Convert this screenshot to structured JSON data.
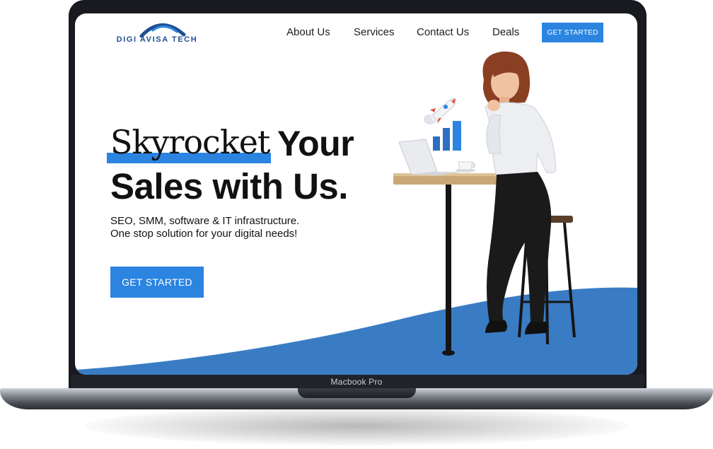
{
  "device": {
    "model_label": "Macbook Pro"
  },
  "brand": {
    "logo_text": "DIGI AVISA TECH",
    "logo_icon": "arc-swoosh-icon"
  },
  "nav": {
    "items": [
      {
        "label": "About Us"
      },
      {
        "label": "Services"
      },
      {
        "label": "Contact Us"
      },
      {
        "label": "Deals"
      }
    ],
    "cta_label": "GET STARTED"
  },
  "hero": {
    "headline_script": "Skyrocket",
    "headline_bold_1": "Your",
    "headline_bold_2": "Sales with Us.",
    "subtext": "SEO, SMM, software & IT infrastructure. One stop solution for your digital needs!",
    "cta_label": "GET STARTED",
    "illustration_icons": [
      "rocket-icon",
      "bar-chart-icon",
      "laptop-icon",
      "coffee-cup-icon"
    ]
  },
  "colors": {
    "accent": "#2b84e0",
    "wave": "#3a7cc4",
    "text": "#111111",
    "logo": "#1f4f93"
  }
}
